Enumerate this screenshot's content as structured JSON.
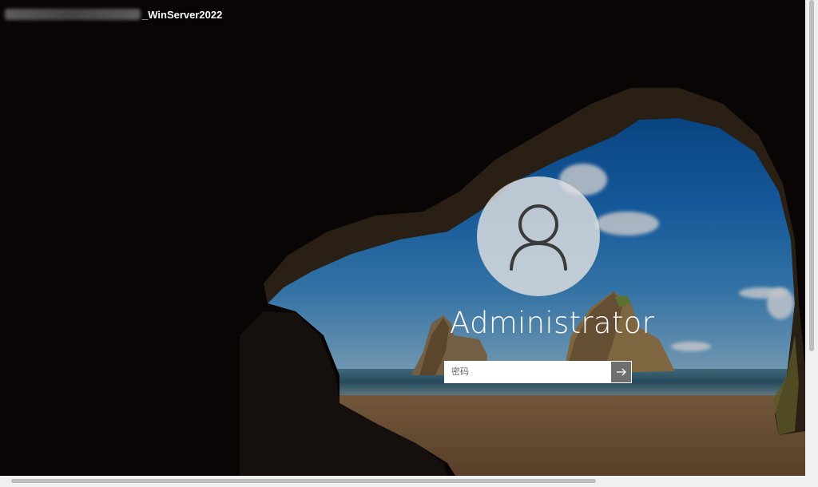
{
  "window": {
    "title_suffix": "_WinServer2022"
  },
  "login": {
    "username": "Administrator",
    "password_placeholder": "密码",
    "submit_icon": "arrow-right-icon",
    "avatar_icon": "user-icon"
  },
  "colors": {
    "submit_button": "#6f6f6f",
    "avatar_bg": "#e1e1e1",
    "text": "#ffffff"
  }
}
